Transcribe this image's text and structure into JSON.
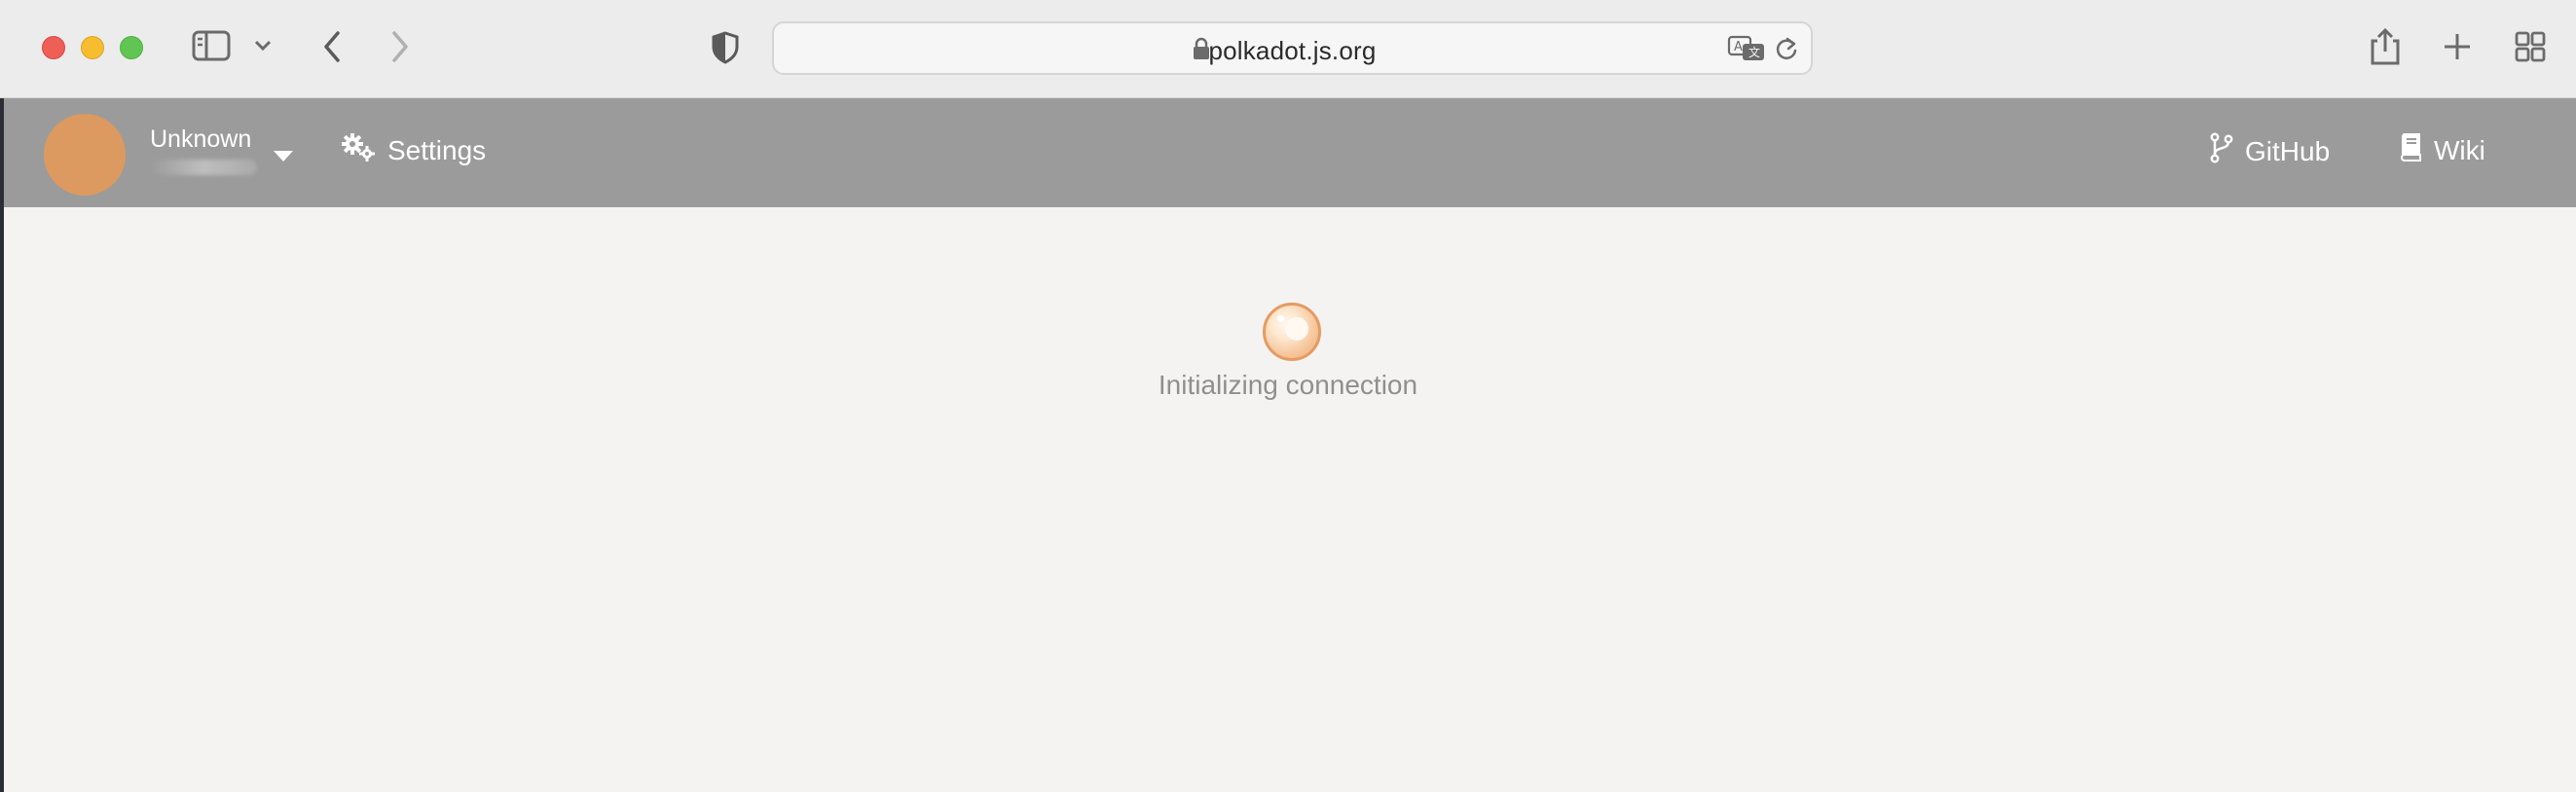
{
  "browser": {
    "url": "polkadot.js.org",
    "icons": [
      "sidebar-icon",
      "chevron-down-icon",
      "back-icon",
      "forward-icon",
      "shield-icon",
      "lock-icon",
      "translate-icon",
      "reload-icon",
      "share-icon",
      "new-tab-icon",
      "tab-overview-icon"
    ]
  },
  "header": {
    "account": {
      "name": "Unknown"
    },
    "settings_label": "Settings",
    "github_label": "GitHub",
    "wiki_label": "Wiki"
  },
  "content": {
    "status": "Initializing connection"
  },
  "colors": {
    "header_bg": "#9b9b9b",
    "avatar": "#dc9a60",
    "page_bg": "#f4f3f2",
    "spinner_border": "#e59b62"
  }
}
